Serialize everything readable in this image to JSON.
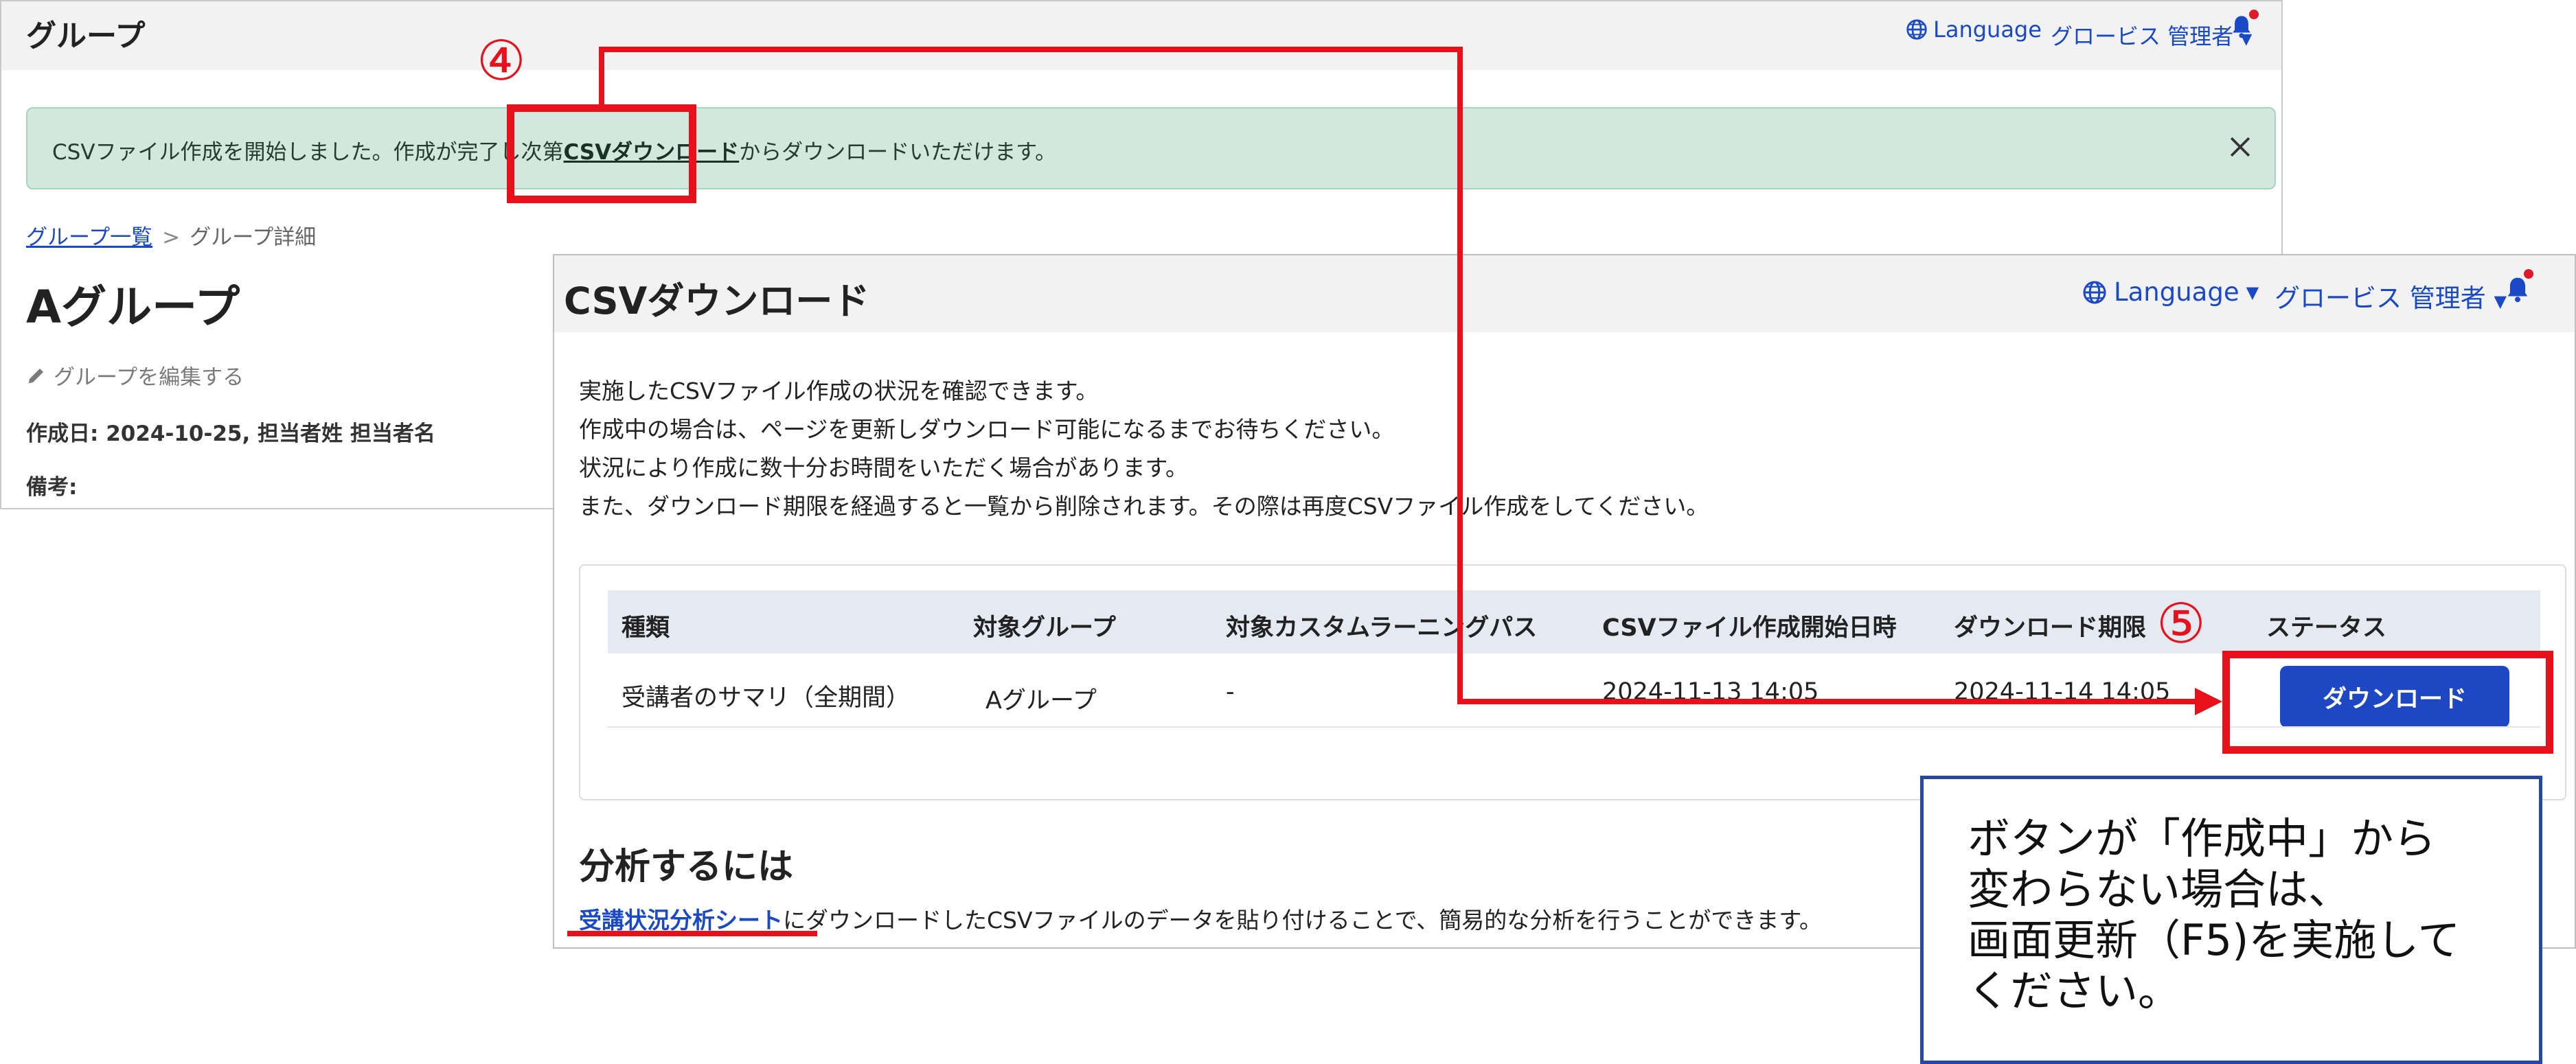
{
  "group_window": {
    "title": "グループ",
    "header": {
      "language": "Language",
      "user": "グロービス 管理者"
    },
    "alert": {
      "before": "CSVファイル作成を開始しました。作成が完了し次第",
      "link": "CSVダウンロード",
      "after": "からダウンロードいただけます。"
    },
    "breadcrumb": {
      "parent": "グループ一覧",
      "separator": ">",
      "current": "グループ詳細"
    },
    "page_title": "Aグループ",
    "edit_label": "グループを編集する",
    "created": "作成日: 2024-10-25, 担当者姓 担当者名",
    "note_label": "備考:"
  },
  "csv_window": {
    "title": "CSVダウンロード",
    "header": {
      "language": "Language",
      "user": "グロービス 管理者"
    },
    "intro": [
      "実施したCSVファイル作成の状況を確認できます。",
      "作成中の場合は、ページを更新しダウンロード可能になるまでお待ちください。",
      "状況により作成に数十分お時間をいただく場合があります。",
      "また、ダウンロード期限を経過すると一覧から削除されます。その際は再度CSVファイル作成をしてください。"
    ],
    "table": {
      "headers": [
        "種類",
        "対象グループ",
        "対象カスタムラーニングパス",
        "CSVファイル作成開始日時",
        "ダウンロード期限",
        "ステータス"
      ],
      "rows": [
        {
          "type": "受講者のサマリ（全期間）",
          "group": "Aグループ",
          "path": "-",
          "start": "2024-11-13 14:05",
          "deadline": "2024-11-14 14:05",
          "status_button": "ダウンロード"
        }
      ]
    },
    "analysis": {
      "heading": "分析するには",
      "link": "受講状況分析シート",
      "text": "にダウンロードしたCSVファイルのデータを貼り付けることで、簡易的な分析を行うことができます。"
    }
  },
  "annotations": {
    "step4": "④",
    "step5": "⑤",
    "callout": [
      "ボタンが「作成中」から",
      "変わらない場合は、",
      "画面更新（F5)を実施して",
      "ください。"
    ],
    "highlight_color": "#e8101a",
    "callout_border_color": "#2547a6"
  },
  "colors": {
    "link": "#1a49c8",
    "button": "#1e47c4",
    "alert_bg": "#d2e7dd",
    "table_header_bg": "#e5e9f2"
  }
}
